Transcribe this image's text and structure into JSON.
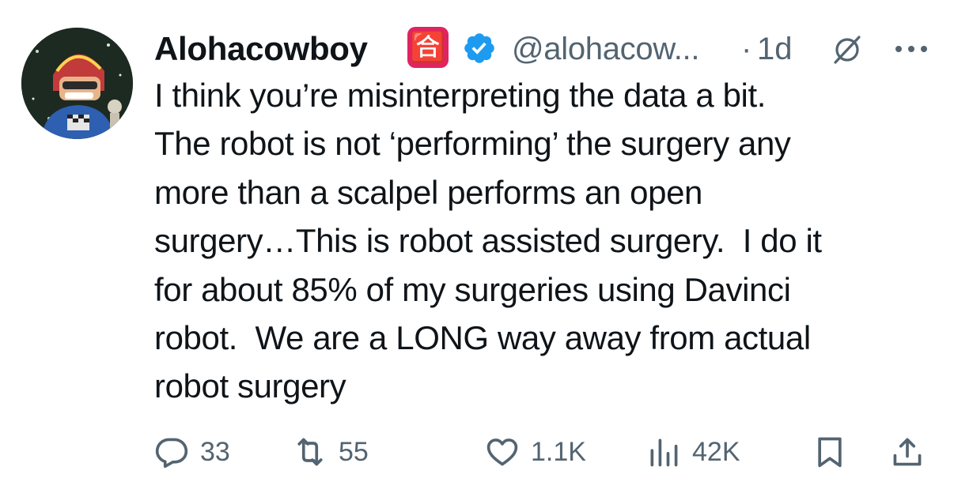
{
  "author": {
    "name": "Alohacowboy",
    "badge_emoji": "🈴",
    "verified_icon": "verified-badge-icon",
    "handle": "@alohacow...",
    "separator": "·",
    "time": "1d"
  },
  "tweet": {
    "text": "I think you’re misinterpreting the data a bit.\nThe robot is not ‘performing’ the surgery any\nmore than a scalpel performs an open\nsurgery…This is robot assisted surgery.  I do it\nfor about 85% of my surgeries using Davinci\nrobot.  We are a LONG way away from actual\nrobot surgery"
  },
  "actions": {
    "replies": "33",
    "reposts": "55",
    "likes": "1.1K",
    "views": "42K"
  },
  "colors": {
    "text": "#0f1419",
    "secondary": "#536471",
    "verified": "#1d9bf0",
    "badge": "#e0245e"
  }
}
